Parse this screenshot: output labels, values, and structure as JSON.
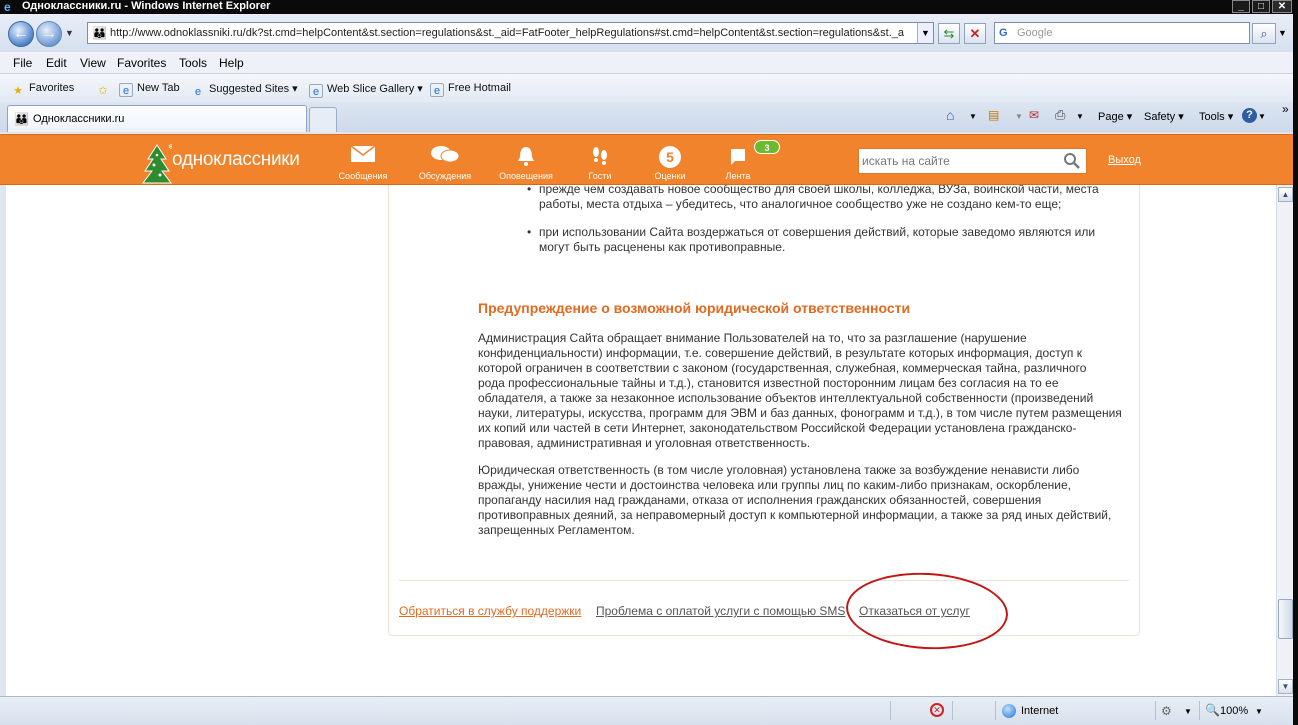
{
  "window": {
    "title": "Одноклассники.ru - Windows Internet Explorer"
  },
  "address": {
    "url": "http://www.odnoklassniki.ru/dk?st.cmd=helpContent&st.section=regulations&st._aid=FatFooter_helpRegulations#st.cmd=helpContent&st.section=regulations&st._a"
  },
  "search": {
    "placeholder": "Google"
  },
  "menu": [
    "File",
    "Edit",
    "View",
    "Favorites",
    "Tools",
    "Help"
  ],
  "favbar": {
    "favorites": "Favorites",
    "items": [
      "New Tab",
      "Suggested Sites ▾",
      "Web Slice Gallery ▾",
      "Free Hotmail"
    ]
  },
  "tab": {
    "label": "Одноклассники.ru"
  },
  "commandbar": {
    "page": "Page ▾",
    "safety": "Safety ▾",
    "tools": "Tools ▾"
  },
  "site": {
    "logo": "одноклассники",
    "nav": [
      {
        "label": "Сообщения",
        "icon": "envelope-icon"
      },
      {
        "label": "Обсуждения",
        "icon": "speech-bubbles-icon"
      },
      {
        "label": "Оповещения",
        "icon": "bell-icon"
      },
      {
        "label": "Гости",
        "icon": "footprints-icon"
      },
      {
        "label": "Оценки",
        "icon": "rating-icon",
        "value": "5"
      },
      {
        "label": "Лента",
        "icon": "feed-icon"
      }
    ],
    "feed_badge": "3",
    "search_placeholder": "искать на сайте",
    "logout": "Выход",
    "accent": "#f0832b"
  },
  "content": {
    "bullet1_line1": "прежде чем создавать новое сообщество для своей школы, колледжа, ВУЗа, воинской части, места",
    "bullet1_line2": "работы, места отдыха – убедитесь, что аналогичное сообщество уже не создано кем-то еще;",
    "bullet2_line1": "при использовании Сайта воздержаться от совершения действий, которые заведомо являются или",
    "bullet2_line2": "могут быть расценены как противоправные.",
    "heading": "Предупреждение о возможной юридической ответственности",
    "para1": [
      "Администрация Сайта обращает внимание Пользователей на то, что за разглашение (нарушение",
      "конфиденциальности) информации, т.е. совершение действий, в результате которых информация, доступ к",
      "которой ограничен в соответствии с законом (государственная, служебная, коммерческая тайна, различного",
      "рода профессиональные тайны и т.д.), становится известной посторонним лицам без согласия на то ее",
      "обладателя, а также за незаконное использование объектов интеллектуальной собственности (произведений",
      "науки, литературы, искусства, программ для ЭВМ и баз данных, фонограмм и т.д.), в том числе путем размещения",
      "их копий или частей в сети Интернет, законодательством Российской Федерации установлена гражданско-",
      "правовая, административная и уголовная ответственность."
    ],
    "para2": [
      "Юридическая ответственность (в том числе уголовная) установлена также за возбуждение ненависти либо",
      "вражды, унижение чести и достоинства человека или группы лиц по каким-либо признакам, оскорбление,",
      "пропаганду насилия над гражданами, отказа от исполнения гражданских обязанностей, совершения",
      "противоправных деяний, за неправомерный доступ к компьютерной информации, а также за ряд иных действий,",
      "запрещенных Регламентом."
    ],
    "footer_links": {
      "support": "Обратиться в службу поддержки",
      "sms": "Проблема с оплатой услуги с помощью SMS",
      "refuse": "Отказаться от услуг"
    }
  },
  "status": {
    "zone": "Internet",
    "zoom": "100%"
  },
  "colors": {
    "heading": "#e26a21",
    "link_orange": "#e26a21",
    "annotation": "#c41414"
  }
}
